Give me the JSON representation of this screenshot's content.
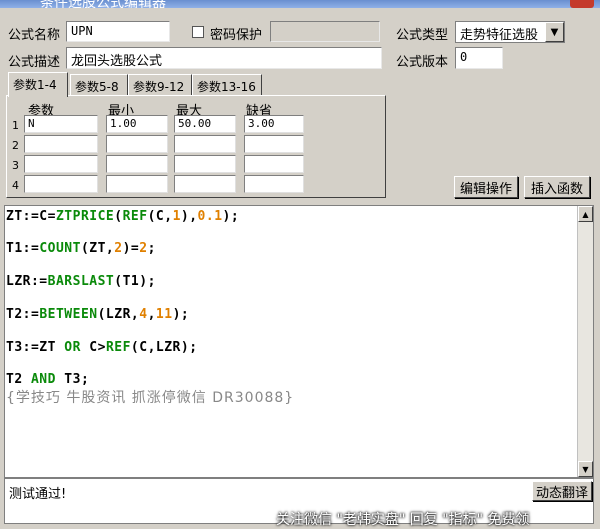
{
  "window": {
    "title": "条件选股公式编辑器"
  },
  "form": {
    "name_label": "公式名称",
    "name_value": "UPN",
    "password_label": "密码保护",
    "password_value": "",
    "type_label": "公式类型",
    "type_value": "走势特征选股",
    "desc_label": "公式描述",
    "desc_value": "龙回头选股公式",
    "version_label": "公式版本",
    "version_value": "0"
  },
  "tabs": [
    "参数1-4",
    "参数5-8",
    "参数9-12",
    "参数13-16"
  ],
  "params": {
    "headers": [
      "参数",
      "最小",
      "最大",
      "缺省"
    ],
    "rows": [
      {
        "n": "1",
        "name": "N",
        "min": "1.00",
        "max": "50.00",
        "default": "3.00"
      },
      {
        "n": "2",
        "name": "",
        "min": "",
        "max": "",
        "default": ""
      },
      {
        "n": "3",
        "name": "",
        "min": "",
        "max": "",
        "default": ""
      },
      {
        "n": "4",
        "name": "",
        "min": "",
        "max": "",
        "default": ""
      }
    ]
  },
  "buttons": {
    "edit_ops": "编辑操作",
    "insert_func": "插入函数",
    "dynamic_translate": "动态翻译"
  },
  "code": {
    "lines": [
      "ZT:=C=ZTPRICE(REF(C,1),0.1);",
      "T1:=COUNT(ZT,2)=2;",
      "LZR:=BARSLAST(T1);",
      "T2:=BETWEEN(LZR,4,11);",
      "T3:=ZT OR C>REF(C,LZR);",
      "T2 AND T3;"
    ],
    "comment": "{学技巧 牛股资讯 抓涨停微信 DR30088}"
  },
  "status": {
    "text": "测试通过!"
  },
  "watermark": "关注微信 \"老韩实盘\" 回复 \"指标\" 免费领",
  "colors": {
    "function": "#0a8a0a",
    "number": "#e08000",
    "comment": "#888888"
  }
}
